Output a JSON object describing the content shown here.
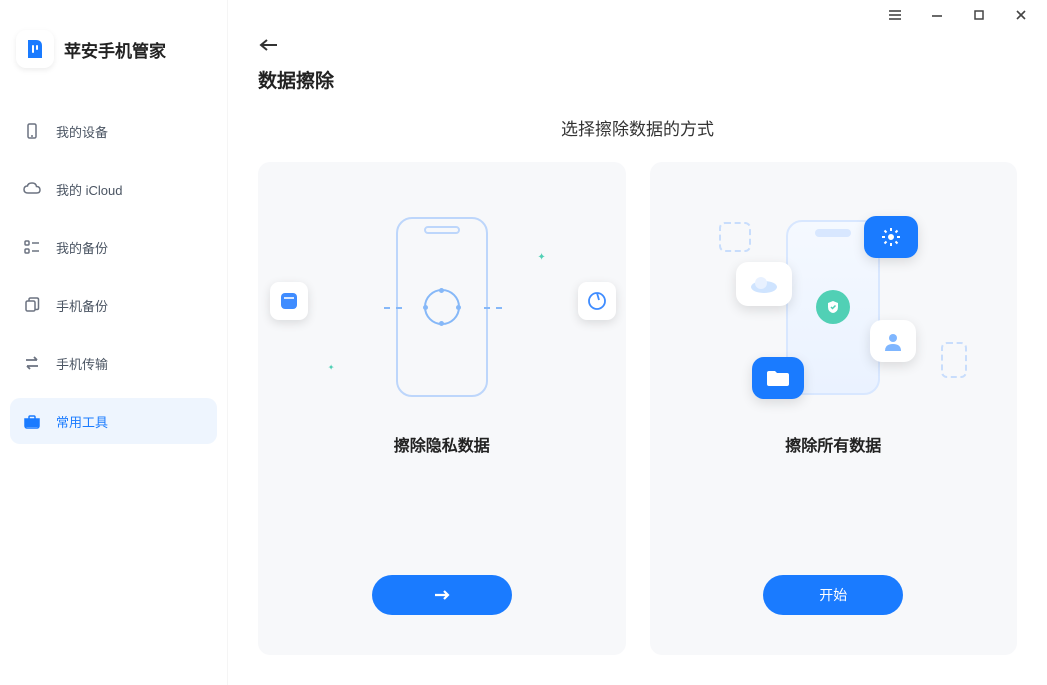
{
  "brand": {
    "title": "苹安手机管家"
  },
  "sidebar": {
    "items": [
      {
        "label": "我的设备"
      },
      {
        "label": "我的 iCloud"
      },
      {
        "label": "我的备份"
      },
      {
        "label": "手机备份"
      },
      {
        "label": "手机传输"
      },
      {
        "label": "常用工具"
      }
    ]
  },
  "page": {
    "title": "数据擦除",
    "subtitle": "选择擦除数据的方式"
  },
  "cards": {
    "privacy": {
      "title": "擦除隐私数据"
    },
    "all": {
      "title": "擦除所有数据",
      "button": "开始"
    }
  }
}
